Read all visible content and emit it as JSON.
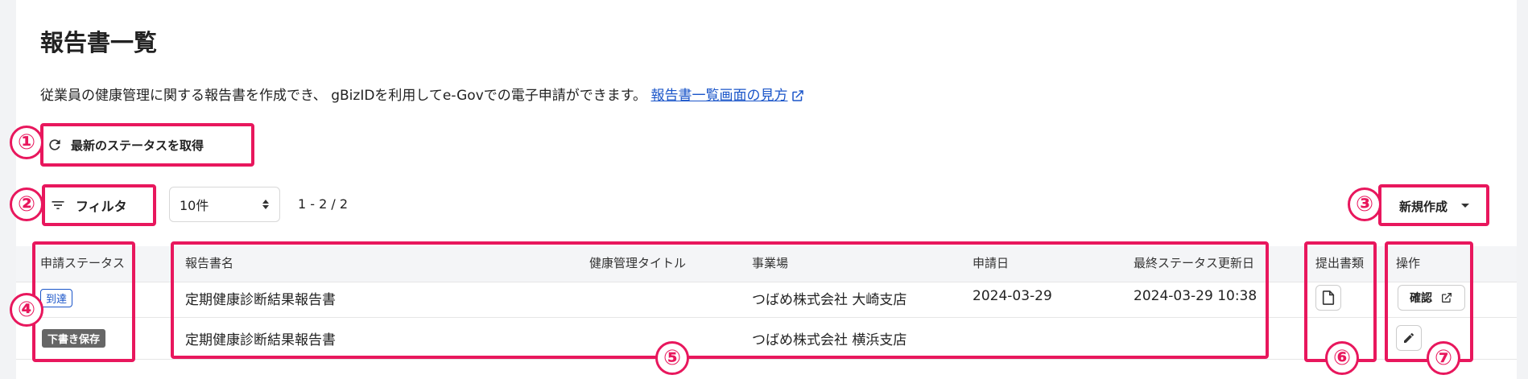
{
  "page": {
    "title": "報告書一覧",
    "description": "従業員の健康管理に関する報告書を作成でき、 gBizIDを利用してe-Govでの電子申請ができます。",
    "help_link": "報告書一覧画面の見方"
  },
  "toolbar": {
    "refresh_label": "最新のステータスを取得",
    "filter_label": "フィルタ",
    "page_size_selected": "10件",
    "pagination": "1 - 2 / 2",
    "new_label": "新規作成"
  },
  "table": {
    "headers": {
      "status": "申請ステータス",
      "report_name": "報告書名",
      "health_title": "健康管理タイトル",
      "office": "事業場",
      "apply_date": "申請日",
      "last_update": "最終ステータス更新日",
      "documents": "提出書類",
      "actions": "操作"
    },
    "rows": [
      {
        "status": "到達",
        "report_name": "定期健康診断結果報告書",
        "health_title": "",
        "office": "つばめ株式会社 大崎支店",
        "apply_date": "2024-03-29",
        "last_update": "2024-03-29 10:38",
        "action_label": "確認"
      },
      {
        "status": "下書き保存",
        "report_name": "定期健康診断結果報告書",
        "health_title": "",
        "office": "つばめ株式会社 横浜支店",
        "apply_date": "",
        "last_update": ""
      }
    ]
  },
  "annotations": [
    "①",
    "②",
    "③",
    "④",
    "⑤",
    "⑥",
    "⑦"
  ],
  "colors": {
    "highlight": "#e8175d",
    "link": "#1a55c9",
    "draft_badge": "#666666"
  }
}
